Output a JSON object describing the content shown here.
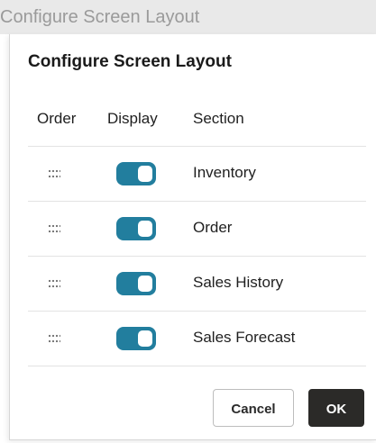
{
  "window": {
    "title": "Configure Screen Layout"
  },
  "dialog": {
    "title": "Configure Screen Layout",
    "columns": {
      "order": "Order",
      "display": "Display",
      "section": "Section"
    },
    "rows": [
      {
        "section": "Inventory",
        "display_on": true
      },
      {
        "section": "Order",
        "display_on": true
      },
      {
        "section": "Sales History",
        "display_on": true
      },
      {
        "section": "Sales Forecast",
        "display_on": true
      }
    ],
    "buttons": {
      "cancel": "Cancel",
      "ok": "OK"
    }
  },
  "icons": {
    "drag_handle": "drag-handle-icon"
  },
  "colors": {
    "toggle_on": "#227e9e",
    "primary_button": "#2b2a28",
    "title_bar_bg": "#e9e9e9"
  }
}
